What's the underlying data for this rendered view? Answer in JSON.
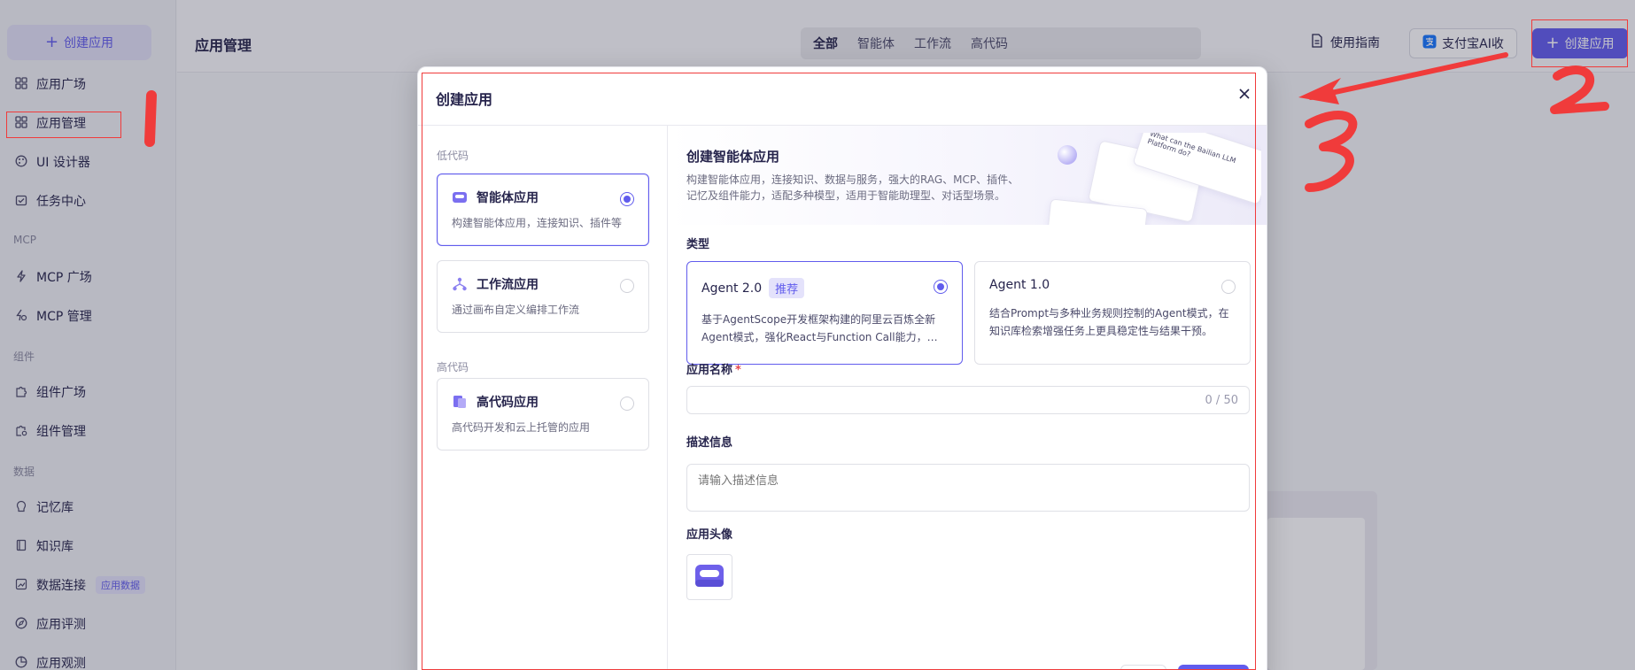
{
  "sidebar": {
    "create_label": "创建应用",
    "items": [
      {
        "label": "应用广场",
        "icon": "grid-icon"
      },
      {
        "label": "应用管理",
        "icon": "grid-icon"
      },
      {
        "label": "UI 设计器",
        "icon": "palette-icon"
      },
      {
        "label": "任务中心",
        "icon": "task-icon"
      },
      {
        "label": "MCP 广场",
        "icon": "lightning-icon"
      },
      {
        "label": "MCP 管理",
        "icon": "lightning-gear-icon"
      },
      {
        "label": "组件广场",
        "icon": "puzzle-icon"
      },
      {
        "label": "组件管理",
        "icon": "puzzle-gear-icon"
      },
      {
        "label": "记忆库",
        "icon": "memory-icon"
      },
      {
        "label": "知识库",
        "icon": "book-icon"
      },
      {
        "label": "数据连接",
        "icon": "chart-icon",
        "badge": "应用数据"
      },
      {
        "label": "应用评测",
        "icon": "compass-icon"
      },
      {
        "label": "应用观测",
        "icon": "pie-icon"
      }
    ],
    "groups": [
      "MCP",
      "组件",
      "数据"
    ]
  },
  "header": {
    "title": "应用管理",
    "tabs": [
      "全部",
      "智能体",
      "工作流",
      "高代码"
    ],
    "guide_label": "使用指南",
    "alipay_label": "支付宝AI收",
    "create_label": "创建应用"
  },
  "modal": {
    "title": "创建应用",
    "groups": {
      "low_code": "低代码",
      "high_code": "高代码"
    },
    "app_types": [
      {
        "title": "智能体应用",
        "desc": "构建智能体应用，连接知识、插件等",
        "selected": true
      },
      {
        "title": "工作流应用",
        "desc": "通过画布自定义编排工作流",
        "selected": false
      },
      {
        "title": "高代码应用",
        "desc": "高代码开发和云上托管的应用",
        "selected": false
      }
    ],
    "banner": {
      "title": "创建智能体应用",
      "desc": "构建智能体应用，连接知识、数据与服务，强大的RAG、MCP、插件、记忆及组件能力，适配多种模型，适用于智能助理型、对话型场景。",
      "art_text": "What can the Bailian LLM Platform do?"
    },
    "type_label": "类型",
    "agents": [
      {
        "title": "Agent 2.0",
        "badge": "推荐",
        "desc": "基于AgentScope开发框架构建的阿里云百炼全新Agent模式，强化React与Function Call能力，适用于复杂任务场景",
        "selected": true
      },
      {
        "title": "Agent 1.0",
        "badge": "",
        "desc": "结合Prompt与多种业务规则控制的Agent模式，在知识库检索增强任务上更具稳定性与结果干预。",
        "selected": false
      }
    ],
    "name_label": "应用名称",
    "name_required": "*",
    "name_count": "0 / 50",
    "desc_label": "描述信息",
    "desc_placeholder": "请输入描述信息",
    "avatar_label": "应用头像"
  },
  "annotations": {
    "color": "#f03b3b",
    "marks": [
      "1",
      "2",
      "3"
    ]
  },
  "colors": {
    "accent": "#615ced",
    "annotation": "#f03b3b"
  }
}
